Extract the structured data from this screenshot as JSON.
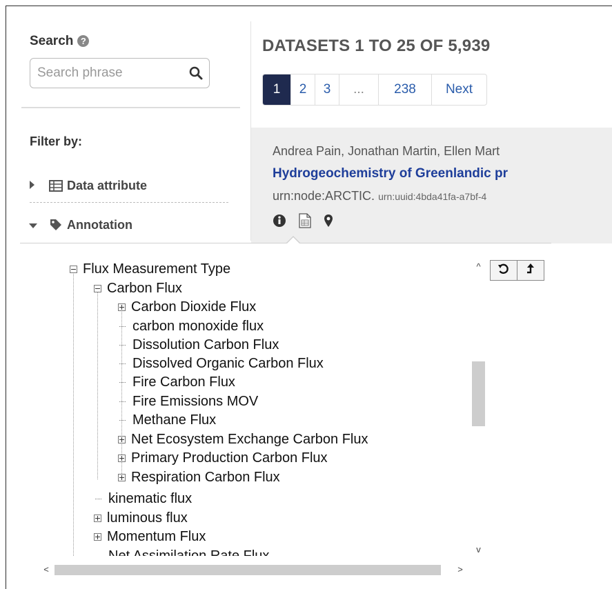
{
  "sidebar": {
    "search_label": "Search",
    "search_placeholder": "Search phrase",
    "filter_label": "Filter by:",
    "facets": [
      {
        "label": "Data attribute",
        "icon": "table-icon",
        "expanded": false
      },
      {
        "label": "Annotation",
        "icon": "tag-icon",
        "expanded": true
      }
    ]
  },
  "results": {
    "title": "DATASETS 1 TO 25 OF 5,939",
    "pages": [
      "1",
      "2",
      "3",
      "...",
      "238",
      "Next"
    ],
    "active_page": "1",
    "first_result": {
      "authors": "Andrea Pain, Jonathan Martin, Ellen Mart",
      "title": "Hydrogeochemistry of Greenlandic pr",
      "node": "urn:node:ARCTIC.",
      "uuid": "urn:uuid:4bda41fa-a7bf-4",
      "icons": [
        "info-icon",
        "document-icon",
        "map-marker-icon"
      ]
    }
  },
  "tree": {
    "items": [
      {
        "label": "Flux Measurement Type",
        "toggle": "minus"
      },
      {
        "label": "Carbon Flux",
        "toggle": "minus"
      },
      {
        "label": "Carbon Dioxide Flux",
        "toggle": "plus"
      },
      {
        "label": "carbon monoxide flux",
        "toggle": "leaf"
      },
      {
        "label": "Dissolution Carbon Flux",
        "toggle": "leaf"
      },
      {
        "label": "Dissolved Organic Carbon Flux",
        "toggle": "leaf"
      },
      {
        "label": "Fire Carbon Flux",
        "toggle": "leaf"
      },
      {
        "label": "Fire Emissions MOV",
        "toggle": "leaf"
      },
      {
        "label": "Methane Flux",
        "toggle": "leaf"
      },
      {
        "label": "Net Ecosystem Exchange Carbon Flux",
        "toggle": "plus"
      },
      {
        "label": "Primary Production Carbon Flux",
        "toggle": "plus"
      },
      {
        "label": "Respiration Carbon Flux",
        "toggle": "plus"
      },
      {
        "label": "kinematic flux",
        "toggle": "leaf"
      },
      {
        "label": "luminous flux",
        "toggle": "plus"
      },
      {
        "label": "Momentum Flux",
        "toggle": "plus"
      },
      {
        "label": "Net Assimilation Rate Flux",
        "toggle": "leaf"
      }
    ],
    "tool_buttons": [
      "reset-icon",
      "collapse-up-icon"
    ]
  },
  "colors": {
    "accent": "#1f2a4f",
    "link": "#2a5cab",
    "result_title": "#1e3e9a"
  }
}
